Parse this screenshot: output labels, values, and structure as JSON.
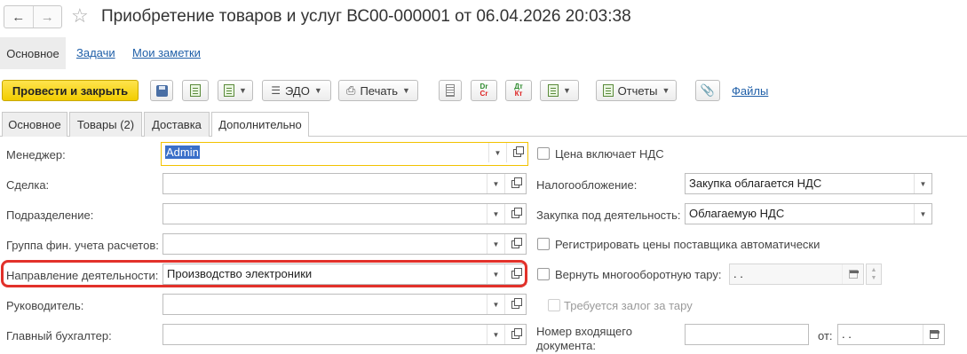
{
  "title": "Приобретение товаров и услуг ВС00-000001 от 06.04.2026 20:03:38",
  "form_nav": {
    "main": "Основное",
    "tasks": "Задачи",
    "notes": "Мои заметки"
  },
  "toolbar": {
    "post_close": "Провести и закрыть",
    "edo": "ЭДО",
    "print": "Печать",
    "reports": "Отчеты",
    "files": "Файлы",
    "dc_dr": "Dr",
    "dc_cr": "Cr",
    "dc_dt": "Дт",
    "dc_kt": "Кт"
  },
  "tabs": [
    "Основное",
    "Товары (2)",
    "Доставка",
    "Дополнительно"
  ],
  "active_tab": "Дополнительно",
  "left_fields": [
    {
      "label": "Менеджер:",
      "value": "Admin"
    },
    {
      "label": "Сделка:",
      "value": ""
    },
    {
      "label": "Подразделение:",
      "value": ""
    },
    {
      "label": "Группа фин. учета расчетов:",
      "value": ""
    },
    {
      "label": "Направление деятельности:",
      "value": "Производство электроники"
    },
    {
      "label": "Руководитель:",
      "value": ""
    },
    {
      "label": "Главный бухгалтер:",
      "value": ""
    }
  ],
  "right": {
    "price_incl_vat": "Цена включает НДС",
    "taxation_label": "Налогообложение:",
    "taxation_value": "Закупка облагается НДС",
    "purchase_label": "Закупка под деятельность:",
    "purchase_value": "Облагаемую НДС",
    "register_prices": "Регистрировать цены поставщика автоматически",
    "return_tare": "Вернуть многооборотную тару:",
    "return_date": " .  .",
    "deposit_required": "Требуется залог за тару",
    "incoming_doc_label_1": "Номер входящего",
    "incoming_doc_label_2": "документа:",
    "from_label": "от:",
    "from_date": " .  ."
  },
  "colors": {
    "primary_button": "#f2cd00",
    "highlight": "#e2312a",
    "link": "#1f5fa8",
    "focus": "#f2c200"
  }
}
